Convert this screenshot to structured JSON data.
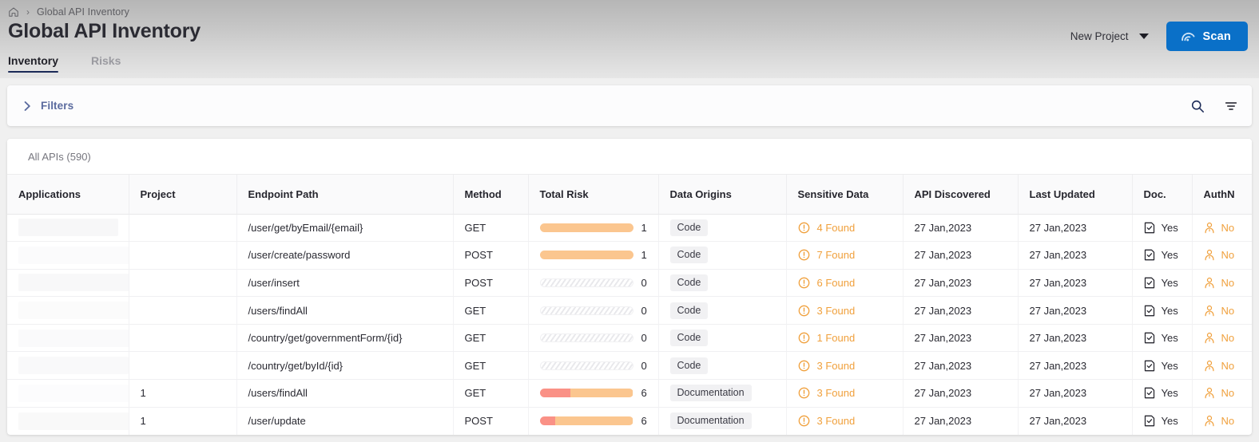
{
  "header": {
    "breadcrumb": {
      "home_icon": "home-icon",
      "separator": "›",
      "label": "Global API Inventory"
    },
    "title": "Global API Inventory",
    "tabs": [
      {
        "label": "Inventory",
        "active": true
      },
      {
        "label": "Risks",
        "active": false
      }
    ],
    "project_select": {
      "label": "New Project",
      "icon": "chevron-down-icon"
    },
    "scan_button": {
      "label": "Scan",
      "icon": "scan-radar-icon",
      "color": "#0a70c8"
    }
  },
  "filter_bar": {
    "toggle_label": "Filters",
    "toggle_icon": "chevron-right-icon",
    "toggle_color": "#5a6a9e",
    "search_icon": "search-icon",
    "filter_icon": "filter-funnel-icon"
  },
  "table": {
    "caption": "All APIs (590)",
    "columns": [
      "Applications",
      "Project",
      "Endpoint Path",
      "Method",
      "Total Risk",
      "Data Origins",
      "Sensitive Data",
      "API Discovered",
      "Last Updated",
      "Doc.",
      "AuthN"
    ],
    "colors": {
      "risk_high": "#fa9186",
      "risk_medium": "#fbc68f",
      "sensitive_text": "#f0a03c",
      "authn_no": "#f0a03c"
    },
    "rows": [
      {
        "applications": "",
        "project": "",
        "endpoint_path": "/user/get/byEmail/{email}",
        "method": "GET",
        "risk_value": "1",
        "risk_high_pct": 0,
        "risk_med_pct": 100,
        "data_origin": "Code",
        "sensitive": "4 Found",
        "api_discovered": "27 Jan,2023",
        "last_updated": "27 Jan,2023",
        "doc": "Yes",
        "authn": "No"
      },
      {
        "applications": "",
        "project": "",
        "endpoint_path": "/user/create/password",
        "method": "POST",
        "risk_value": "1",
        "risk_high_pct": 0,
        "risk_med_pct": 100,
        "data_origin": "Code",
        "sensitive": "7 Found",
        "api_discovered": "27 Jan,2023",
        "last_updated": "27 Jan,2023",
        "doc": "Yes",
        "authn": "No"
      },
      {
        "applications": "",
        "project": "",
        "endpoint_path": "/user/insert",
        "method": "POST",
        "risk_value": "0",
        "risk_high_pct": 0,
        "risk_med_pct": 0,
        "data_origin": "Code",
        "sensitive": "6 Found",
        "api_discovered": "27 Jan,2023",
        "last_updated": "27 Jan,2023",
        "doc": "Yes",
        "authn": "No"
      },
      {
        "applications": "",
        "project": "",
        "endpoint_path": "/users/findAll",
        "method": "GET",
        "risk_value": "0",
        "risk_high_pct": 0,
        "risk_med_pct": 0,
        "data_origin": "Code",
        "sensitive": "3 Found",
        "api_discovered": "27 Jan,2023",
        "last_updated": "27 Jan,2023",
        "doc": "Yes",
        "authn": "No"
      },
      {
        "applications": "",
        "project": "",
        "endpoint_path": "/country/get/governmentForm/{id}",
        "method": "GET",
        "risk_value": "0",
        "risk_high_pct": 0,
        "risk_med_pct": 0,
        "data_origin": "Code",
        "sensitive": "1 Found",
        "api_discovered": "27 Jan,2023",
        "last_updated": "27 Jan,2023",
        "doc": "Yes",
        "authn": "No"
      },
      {
        "applications": "",
        "project": "",
        "endpoint_path": "/country/get/byId/{id}",
        "method": "GET",
        "risk_value": "0",
        "risk_high_pct": 0,
        "risk_med_pct": 0,
        "data_origin": "Code",
        "sensitive": "3 Found",
        "api_discovered": "27 Jan,2023",
        "last_updated": "27 Jan,2023",
        "doc": "Yes",
        "authn": "No"
      },
      {
        "applications": "",
        "project": "1",
        "endpoint_path": "/users/findAll",
        "method": "GET",
        "risk_value": "6",
        "risk_high_pct": 33,
        "risk_med_pct": 67,
        "data_origin": "Documentation",
        "sensitive": "3 Found",
        "api_discovered": "27 Jan,2023",
        "last_updated": "27 Jan,2023",
        "doc": "Yes",
        "authn": "No"
      },
      {
        "applications": "",
        "project": "1",
        "endpoint_path": "/user/update",
        "method": "POST",
        "risk_value": "6",
        "risk_high_pct": 17,
        "risk_med_pct": 83,
        "data_origin": "Documentation",
        "sensitive": "3 Found",
        "api_discovered": "27 Jan,2023",
        "last_updated": "27 Jan,2023",
        "doc": "Yes",
        "authn": "No"
      }
    ]
  }
}
